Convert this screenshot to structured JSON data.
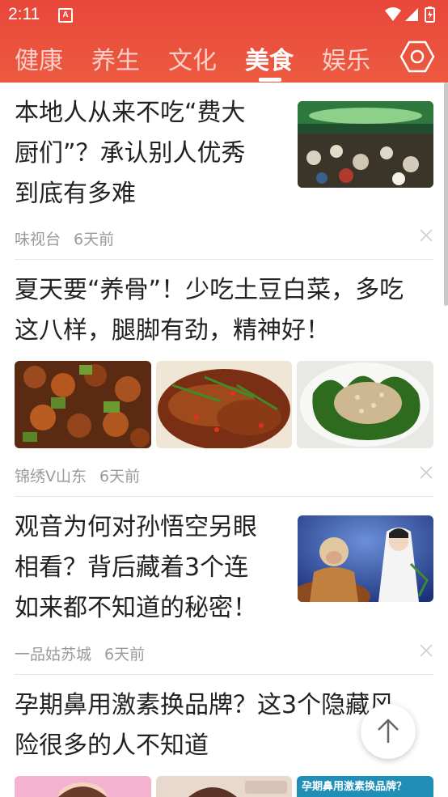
{
  "status_bar": {
    "time": "2:11",
    "notification_letter": "A"
  },
  "tabs": [
    {
      "label": "健康",
      "active": false
    },
    {
      "label": "养生",
      "active": false
    },
    {
      "label": "文化",
      "active": false
    },
    {
      "label": "美食",
      "active": true
    },
    {
      "label": "娱乐",
      "active": false
    }
  ],
  "feed": {
    "items": [
      {
        "title_lines": [
          "本地人从来不吃“费大",
          "厨们”？承认别人优秀",
          "到底有多难"
        ],
        "source": "味视台",
        "time": "6天前",
        "layout": "right-thumb"
      },
      {
        "title_lines": [
          "夏天要“养骨”！少吃土豆白菜，多吃",
          "这八样，腿脚有劲，精神好！"
        ],
        "source": "锦绣V山东",
        "time": "6天前",
        "layout": "three-thumbs"
      },
      {
        "title_lines": [
          "观音为何对孙悟空另眼",
          "相看？背后藏着3个连",
          "如来都不知道的秘密！"
        ],
        "source": "一品姑苏城",
        "time": "6天前",
        "layout": "right-thumb"
      },
      {
        "title_lines": [
          "孕期鼻用激素换品牌？这3个隐藏风",
          "险很多的人不知道"
        ],
        "layout": "three-thumbs",
        "thumb_caption": "孕期鼻用激素换品牌？"
      }
    ]
  },
  "colors": {
    "header": "#e8473a",
    "accent": "#ffffff",
    "text": "#222222",
    "meta": "#9a9a9a"
  }
}
